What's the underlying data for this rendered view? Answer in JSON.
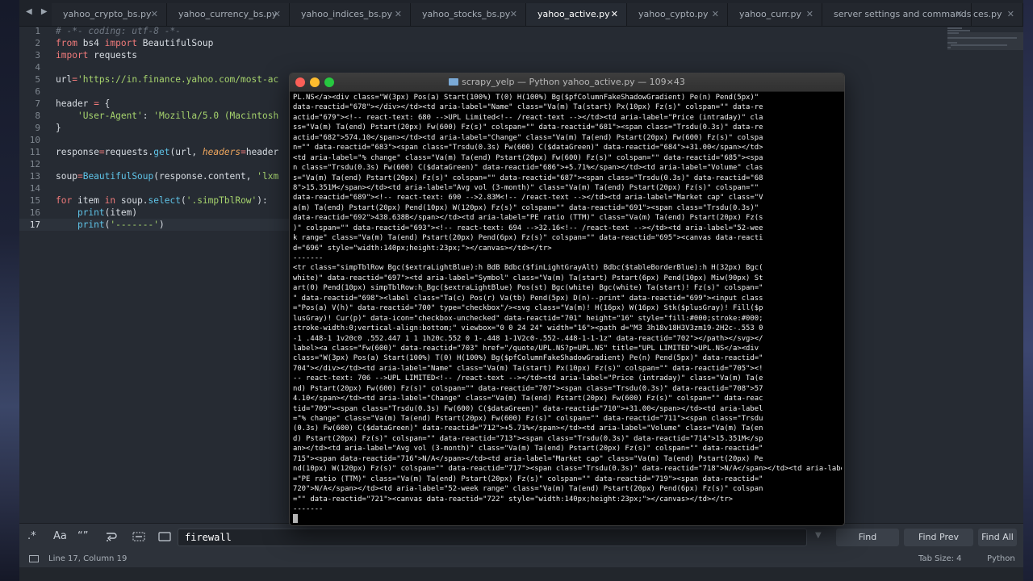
{
  "nav": {
    "back_forward": "◀ ▶"
  },
  "tabs": [
    {
      "label": "yahoo_crypto_bs.py",
      "close": "✕"
    },
    {
      "label": "yahoo_currency_bs.py",
      "close": "✕"
    },
    {
      "label": "yahoo_indices_bs.py",
      "close": "✕"
    },
    {
      "label": "yahoo_stocks_bs.py",
      "close": "✕"
    },
    {
      "label": "yahoo_active.py",
      "close": "✕",
      "active": true
    },
    {
      "label": "yahoo_cypto.py",
      "close": "✕"
    },
    {
      "label": "yahoo_curr.py",
      "close": "✕"
    },
    {
      "label": "server settings and commands",
      "close": "✕"
    },
    {
      "label": "ces.py",
      "close": "✕"
    }
  ],
  "editor": {
    "line_numbers": [
      "1",
      "2",
      "3",
      "4",
      "5",
      "6",
      "7",
      "8",
      "9",
      "10",
      "11",
      "12",
      "13",
      "14",
      "15",
      "16",
      "17"
    ],
    "current_line": "17",
    "code": {
      "l1": "# -*- coding: utf-8 -*-",
      "l2a": "from",
      "l2b": " bs4 ",
      "l2c": "import",
      "l2d": " BeautifulSoup",
      "l3a": "import",
      "l3b": " requests",
      "l5a": "url",
      "l5b": "=",
      "l5c": "'https://in.finance.yahoo.com/most-ac",
      "l7a": "header ",
      "l7b": "=",
      "l7c": " {",
      "l8a": "    ",
      "l8b": "'User-Agent'",
      "l8c": ": ",
      "l8d": "'Mozilla/5.0 (Macintosh",
      "l9": "}",
      "l11a": "response",
      "l11b": "=",
      "l11c": "requests.",
      "l11d": "get",
      "l11e": "(url, ",
      "l11f": "headers",
      "l11g": "=",
      "l11h": "header",
      "l13a": "soup",
      "l13b": "=",
      "l13c": "BeautifulSoup",
      "l13d": "(response.content, ",
      "l13e": "'lxm",
      "l15a": "for",
      "l15b": " item ",
      "l15c": "in",
      "l15d": " soup.",
      "l15e": "select",
      "l15f": "(",
      "l15g": "'.simpTblRow'",
      "l15h": "):",
      "l16a": "    ",
      "l16b": "print",
      "l16c": "(item)",
      "l17a": "    ",
      "l17b": "print",
      "l17c": "(",
      "l17d": "'-------'",
      "l17e": ")"
    }
  },
  "terminal": {
    "title": "scrapy_yelp — Python yahoo_active.py — 109×43",
    "lines": [
      "PL.NS</a><div class=\"W(3px) Pos(a) Start(100%) T(0) H(100%) Bg($pfColumnFakeShadowGradient) Pe(n) Pend(5px)\"",
      "data-reactid=\"678\"></div></td><td aria-label=\"Name\" class=\"Va(m) Ta(start) Px(10px) Fz(s)\" colspan=\"\" data-re",
      "actid=\"679\"><!-- react-text: 680 -->UPL Limited<!-- /react-text --></td><td aria-label=\"Price (intraday)\" cla",
      "ss=\"Va(m) Ta(end) Pstart(20px) Fw(600) Fz(s)\" colspan=\"\" data-reactid=\"681\"><span class=\"Trsdu(0.3s)\" data-re",
      "actid=\"682\">574.10</span></td><td aria-label=\"Change\" class=\"Va(m) Ta(end) Pstart(20px) Fw(600) Fz(s)\" colspa",
      "n=\"\" data-reactid=\"683\"><span class=\"Trsdu(0.3s) Fw(600) C($dataGreen)\" data-reactid=\"684\">+31.00</span></td>",
      "<td aria-label=\"% change\" class=\"Va(m) Ta(end) Pstart(20px) Fw(600) Fz(s)\" colspan=\"\" data-reactid=\"685\"><spa",
      "n class=\"Trsdu(0.3s) Fw(600) C($dataGreen)\" data-reactid=\"686\">+5.71%</span></td><td aria-label=\"Volume\" clas",
      "s=\"Va(m) Ta(end) Pstart(20px) Fz(s)\" colspan=\"\" data-reactid=\"687\"><span class=\"Trsdu(0.3s)\" data-reactid=\"68",
      "8\">15.351M</span></td><td aria-label=\"Avg vol (3-month)\" class=\"Va(m) Ta(end) Pstart(20px) Fz(s)\" colspan=\"\"",
      "data-reactid=\"689\"><!-- react-text: 690 -->2.83M<!-- /react-text --></td><td aria-label=\"Market cap\" class=\"V",
      "a(m) Ta(end) Pstart(20px) Pend(10px) W(120px) Fz(s)\" colspan=\"\" data-reactid=\"691\"><span class=\"Trsdu(0.3s)\"",
      "data-reactid=\"692\">438.638B</span></td><td aria-label=\"PE ratio (TTM)\" class=\"Va(m) Ta(end) Pstart(20px) Fz(s",
      ")\" colspan=\"\" data-reactid=\"693\"><!-- react-text: 694 -->32.16<!-- /react-text --></td><td aria-label=\"52-wee",
      "k range\" class=\"Va(m) Ta(end) Pstart(20px) Pend(6px) Fz(s)\" colspan=\"\" data-reactid=\"695\"><canvas data-reacti",
      "d=\"696\" style=\"width:140px;height:23px;\"></canvas></td></tr>",
      "-------",
      "<tr class=\"simpTblRow Bgc($extraLightBlue):h BdB Bdbc($finLightGrayAlt) Bdbc($tableBorderBlue):h H(32px) Bgc(",
      "white)\" data-reactid=\"697\"><td aria-label=\"Symbol\" class=\"Va(m) Ta(start) Pstart(6px) Pend(10px) Miw(90px) St",
      "art(0) Pend(10px) simpTblRow:h_Bgc($extraLightBlue) Pos(st) Bgc(white) Bgc(white) Ta(start)! Fz(s)\" colspan=\"",
      "\" data-reactid=\"698\"><label class=\"Ta(c) Pos(r) Va(tb) Pend(5px) D(n)--print\" data-reactid=\"699\"><input class",
      "=\"Pos(a) V(h)\" data-reactid=\"700\" type=\"checkbox\"/><svg class=\"Va(m)! H(16px) W(16px) Stk($plusGray)! Fill($p",
      "lusGray)! Cur(p)\" data-icon=\"checkbox-unchecked\" data-reactid=\"701\" height=\"16\" style=\"fill:#000;stroke:#000;",
      "stroke-width:0;vertical-align:bottom;\" viewbox=\"0 0 24 24\" width=\"16\"><path d=\"M3 3h18v18H3V3zm19-2H2c-.553 0",
      "-1 .448-1 1v20c0 .552.447 1 1 1h20c.552 0 1-.448 1-1V2c0-.552-.448-1-1-1z\" data-reactid=\"702\"></path></svg></",
      "label><a class=\"Fw(600)\" data-reactid=\"703\" href=\"/quote/UPL.NS?p=UPL.NS\" title=\"UPL LIMITED\">UPL.NS</a><div",
      "class=\"W(3px) Pos(a) Start(100%) T(0) H(100%) Bg($pfColumnFakeShadowGradient) Pe(n) Pend(5px)\" data-reactid=\"",
      "704\"></div></td><td aria-label=\"Name\" class=\"Va(m) Ta(start) Px(10px) Fz(s)\" colspan=\"\" data-reactid=\"705\"><!",
      "-- react-text: 706 -->UPL LIMITED<!-- /react-text --></td><td aria-label=\"Price (intraday)\" class=\"Va(m) Ta(e",
      "nd) Pstart(20px) Fw(600) Fz(s)\" colspan=\"\" data-reactid=\"707\"><span class=\"Trsdu(0.3s)\" data-reactid=\"708\">57",
      "4.10</span></td><td aria-label=\"Change\" class=\"Va(m) Ta(end) Pstart(20px) Fw(600) Fz(s)\" colspan=\"\" data-reac",
      "tid=\"709\"><span class=\"Trsdu(0.3s) Fw(600) C($dataGreen)\" data-reactid=\"710\">+31.00</span></td><td aria-label",
      "=\"% change\" class=\"Va(m) Ta(end) Pstart(20px) Fw(600) Fz(s)\" colspan=\"\" data-reactid=\"711\"><span class=\"Trsdu",
      "(0.3s) Fw(600) C($dataGreen)\" data-reactid=\"712\">+5.71%</span></td><td aria-label=\"Volume\" class=\"Va(m) Ta(en",
      "d) Pstart(20px) Fz(s)\" colspan=\"\" data-reactid=\"713\"><span class=\"Trsdu(0.3s)\" data-reactid=\"714\">15.351M</sp",
      "an></td><td aria-label=\"Avg vol (3-month)\" class=\"Va(m) Ta(end) Pstart(20px) Fz(s)\" colspan=\"\" data-reactid=\"",
      "715\"><span data-reactid=\"716\">N/A</span></td><td aria-label=\"Market cap\" class=\"Va(m) Ta(end) Pstart(20px) Pe",
      "nd(10px) W(120px) Fz(s)\" colspan=\"\" data-reactid=\"717\"><span class=\"Trsdu(0.3s)\" data-reactid=\"718\">N/A</span></td><td aria-label",
      "=\"PE ratio (TTM)\" class=\"Va(m) Ta(end) Pstart(20px) Fz(s)\" colspan=\"\" data-reactid=\"719\"><span data-reactid=\"",
      "720\">N/A</span></td><td aria-label=\"52-week range\" class=\"Va(m) Ta(end) Pstart(20px) Pend(6px) Fz(s)\" colspan",
      "=\"\" data-reactid=\"721\"><canvas data-reactid=\"722\" style=\"width:140px;height:23px;\"></canvas></td></tr>",
      "-------"
    ]
  },
  "find": {
    "regex": ".*",
    "case": "Aa",
    "whole_word": "“”",
    "query": "firewall",
    "find_label": "Find",
    "find_prev_label": "Find Prev",
    "find_all_label": "Find All"
  },
  "status": {
    "position": "Line 17, Column 19",
    "tab_size": "Tab Size: 4",
    "syntax": "Python"
  }
}
